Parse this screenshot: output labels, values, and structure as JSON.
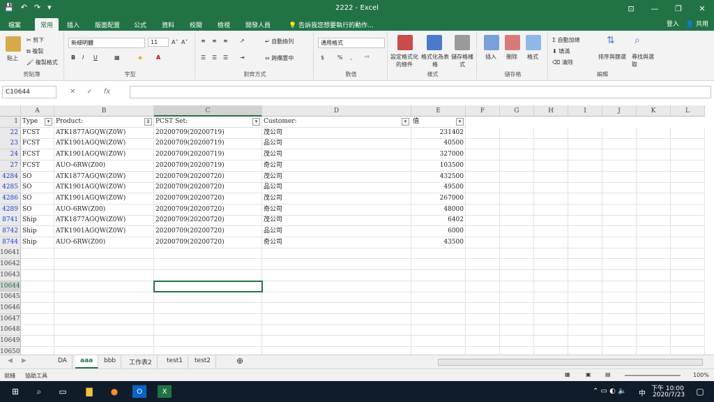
{
  "window": {
    "title": "2222 - Excel",
    "quick_access": [
      "💾",
      "↶",
      "↷",
      "▾"
    ],
    "controls": [
      "⊡",
      "—",
      "❐",
      "✕"
    ]
  },
  "tabs": [
    "檔案",
    "常用",
    "插入",
    "版面配置",
    "公式",
    "資料",
    "校閱",
    "檢視",
    "開發人員"
  ],
  "active_tab": "常用",
  "tellme": "告訴我您想要執行的動作...",
  "account": {
    "signin": "登入",
    "share": "共用"
  },
  "ribbon": {
    "clipboard": {
      "paste": "貼上",
      "cut": "剪下",
      "copy": "複製",
      "painter": "複製格式",
      "label": "剪貼簿"
    },
    "font": {
      "name": "新細明體",
      "size": "11",
      "grow": "A˄",
      "shrink": "A˅",
      "bold": "B",
      "italic": "I",
      "underline": "U",
      "label": "字型"
    },
    "alignment": {
      "wrap": "自動換列",
      "merge": "跨欄置中",
      "label": "對齊方式"
    },
    "number": {
      "format": "通用格式",
      "currency": "$",
      "percent": "%",
      "comma": ",",
      "label": "數值"
    },
    "styles": {
      "cond": "設定格式化的條件",
      "table": "格式化為表格",
      "cell": "儲存格樣式",
      "label": "樣式"
    },
    "cells": {
      "insert": "插入",
      "delete": "刪除",
      "format": "格式",
      "label": "儲存格"
    },
    "editing": {
      "autosum": "自動加總",
      "fill": "填滿",
      "clear": "清除",
      "sort": "排序與篩選",
      "find": "尋找與選取",
      "label": "編輯"
    }
  },
  "formula_bar": {
    "name_box": "C10644",
    "cancel": "✕",
    "enter": "✓",
    "fx": "fx",
    "value": ""
  },
  "columns": [
    "A",
    "B",
    "C",
    "D",
    "E",
    "F",
    "G",
    "H",
    "I",
    "J",
    "K",
    "L"
  ],
  "selected_column": "C",
  "header_row": {
    "row": "1",
    "cells": [
      "Type",
      "Product:",
      "PCST Set:",
      "Customer:",
      "值"
    ]
  },
  "rows": [
    {
      "n": "22",
      "type": "FCST",
      "product": "ATK1877AGQW(Z0W)",
      "set": "20200709(20200719)",
      "customer": "茂公司",
      "value": "231402"
    },
    {
      "n": "23",
      "type": "FCST",
      "product": "ATK1901AGQW(Z0W)",
      "set": "20200709(20200719)",
      "customer": "品公司",
      "value": "40500"
    },
    {
      "n": "24",
      "type": "FCST",
      "product": "ATK1901AGQW(Z0W)",
      "set": "20200709(20200719)",
      "customer": "茂公司",
      "value": "327000"
    },
    {
      "n": "27",
      "type": "FCST",
      "product": "AUO-6RW(Z00)",
      "set": "20200709(20200719)",
      "customer": "奇公司",
      "value": "103500"
    },
    {
      "n": "4284",
      "type": "SO",
      "product": "ATK1877AGQW(Z0W)",
      "set": "20200709(20200720)",
      "customer": "茂公司",
      "value": "432500"
    },
    {
      "n": "4285",
      "type": "SO",
      "product": "ATK1901AGQW(Z0W)",
      "set": "20200709(20200720)",
      "customer": "品公司",
      "value": "49500"
    },
    {
      "n": "4286",
      "type": "SO",
      "product": "ATK1901AGQW(Z0W)",
      "set": "20200709(20200720)",
      "customer": "茂公司",
      "value": "267000"
    },
    {
      "n": "4289",
      "type": "SO",
      "product": "AUO-6RW(Z00)",
      "set": "20200709(20200720)",
      "customer": "奇公司",
      "value": "48000"
    },
    {
      "n": "8741",
      "type": "Ship",
      "product": "ATK1877AGQW(Z0W)",
      "set": "20200709(20200720)",
      "customer": "茂公司",
      "value": "6402"
    },
    {
      "n": "8742",
      "type": "Ship",
      "product": "ATK1901AGQW(Z0W)",
      "set": "20200709(20200720)",
      "customer": "品公司",
      "value": "6000"
    },
    {
      "n": "8744",
      "type": "Ship",
      "product": "AUO-6RW(Z00)",
      "set": "20200709(20200720)",
      "customer": "奇公司",
      "value": "43500"
    }
  ],
  "empty_rows": [
    "10641",
    "10642",
    "10643",
    "10644",
    "10645",
    "10646",
    "10647",
    "10648",
    "10649",
    "10650"
  ],
  "selected_row": "10644",
  "sheets": [
    "DA",
    "aaa",
    "bbb",
    "工作表2",
    "test1",
    "test2"
  ],
  "active_sheet": "aaa",
  "status": {
    "ready": "就緒",
    "access": "協助工具",
    "zoom": "100%"
  },
  "taskbar": {
    "time": "下午 10:00",
    "date": "2020/7/23",
    "ime": "中"
  },
  "colors": {
    "excel_green": "#217346",
    "filtered_row": "#1a3fd0",
    "taskbar": "#101c2a"
  }
}
